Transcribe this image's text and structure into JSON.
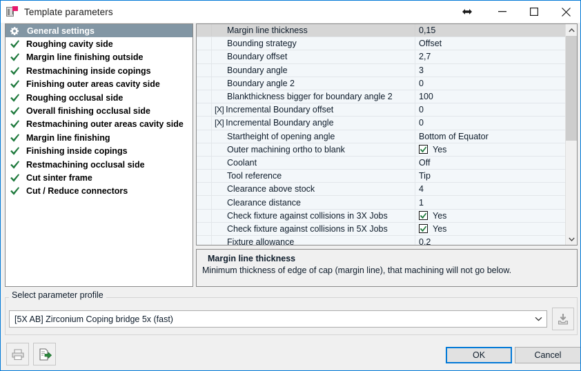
{
  "window": {
    "title": "Template parameters",
    "icon": "template-parameters-icon",
    "controls": {
      "resize": "resize-horizontal-icon",
      "minimize": "minimize-icon",
      "maximize": "maximize-icon",
      "close": "close-icon"
    }
  },
  "sidebar": {
    "items": [
      {
        "label": "General settings",
        "icon": "gear-icon",
        "selected": true
      },
      {
        "label": "Roughing cavity side",
        "icon": "check-icon",
        "selected": false
      },
      {
        "label": "Margin line finishing outside",
        "icon": "check-icon",
        "selected": false
      },
      {
        "label": "Restmachining inside copings",
        "icon": "check-icon",
        "selected": false
      },
      {
        "label": "Finishing outer areas cavity side",
        "icon": "check-icon",
        "selected": false
      },
      {
        "label": "Roughing occlusal side",
        "icon": "check-icon",
        "selected": false
      },
      {
        "label": "Overall finishing occlusal side",
        "icon": "check-icon",
        "selected": false
      },
      {
        "label": "Restmachining outer areas cavity side",
        "icon": "check-icon",
        "selected": false
      },
      {
        "label": "Margin line finishing",
        "icon": "check-icon",
        "selected": false
      },
      {
        "label": "Finishing inside copings",
        "icon": "check-icon",
        "selected": false
      },
      {
        "label": "Restmachining occlusal side",
        "icon": "check-icon",
        "selected": false
      },
      {
        "label": "Cut sinter frame",
        "icon": "check-icon",
        "selected": false
      },
      {
        "label": "Cut / Reduce connectors",
        "icon": "check-icon",
        "selected": false
      }
    ]
  },
  "parameter_grid": {
    "rows": [
      {
        "flag": "",
        "name": "Margin line thickness",
        "value": "0,15",
        "type": "text",
        "selected": true
      },
      {
        "flag": "",
        "name": "Bounding strategy",
        "value": "Offset",
        "type": "text",
        "selected": false
      },
      {
        "flag": "",
        "name": "Boundary offset",
        "value": "2,7",
        "type": "text",
        "selected": false
      },
      {
        "flag": "",
        "name": "Boundary angle",
        "value": "3",
        "type": "text",
        "selected": false
      },
      {
        "flag": "",
        "name": "Boundary angle 2",
        "value": "0",
        "type": "text",
        "selected": false
      },
      {
        "flag": "",
        "name": "Blankthickness bigger for boundary angle 2",
        "value": "100",
        "type": "text",
        "selected": false
      },
      {
        "flag": "[X]",
        "name": "Incremental Boundary offset",
        "value": "0",
        "type": "text",
        "selected": false
      },
      {
        "flag": "[X]",
        "name": "Incremental Boundary angle",
        "value": "0",
        "type": "text",
        "selected": false
      },
      {
        "flag": "",
        "name": "Startheight of opening angle",
        "value": "Bottom of Equator",
        "type": "text",
        "selected": false
      },
      {
        "flag": "",
        "name": "Outer machining ortho to blank",
        "value": "Yes",
        "type": "checkbox",
        "checked": true,
        "selected": false
      },
      {
        "flag": "",
        "name": "Coolant",
        "value": "Off",
        "type": "text",
        "selected": false
      },
      {
        "flag": "",
        "name": "Tool reference",
        "value": "Tip",
        "type": "text",
        "selected": false
      },
      {
        "flag": "",
        "name": "Clearance above stock",
        "value": "4",
        "type": "text",
        "selected": false
      },
      {
        "flag": "",
        "name": "Clearance distance",
        "value": "1",
        "type": "text",
        "selected": false
      },
      {
        "flag": "",
        "name": "Check fixture against collisions in 3X Jobs",
        "value": "Yes",
        "type": "checkbox",
        "checked": true,
        "selected": false
      },
      {
        "flag": "",
        "name": "Check fixture against collisions in 5X Jobs",
        "value": "Yes",
        "type": "checkbox",
        "checked": true,
        "selected": false
      },
      {
        "flag": "",
        "name": "Fixture allowance",
        "value": "0,2",
        "type": "text",
        "selected": false
      }
    ],
    "scrollbar": {
      "up": "chevron-up-icon",
      "down": "chevron-down-icon"
    }
  },
  "description": {
    "title": "Margin line thickness",
    "text": "Minimum thickness of edge of cap (margin line), that machining will not go below."
  },
  "profile": {
    "group_label": "Select parameter profile",
    "selected": "[5X AB] Zirconium Coping bridge 5x (fast)",
    "dropdown_icon": "chevron-down-icon",
    "import_button": "import-profile-icon"
  },
  "toolbar": {
    "print_button": "printer-icon",
    "export_button": "export-document-icon"
  },
  "footer": {
    "ok_label": "OK",
    "cancel_label": "Cancel"
  },
  "colors": {
    "accent": "#0078d7",
    "selection": "#8296a4",
    "check_green": "#1f7a3d",
    "flag_pink": "#e8186b"
  }
}
